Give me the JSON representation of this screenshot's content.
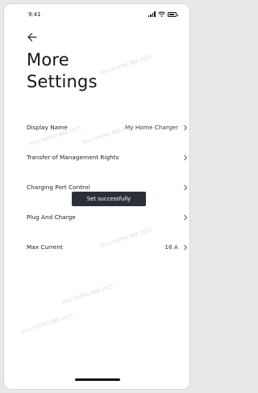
{
  "status_bar": {
    "time": "9:41"
  },
  "page": {
    "title_line1": "More",
    "title_line2": "Settings"
  },
  "settings": {
    "display_name": {
      "label": "Display Name",
      "value": "My Home Charger"
    },
    "transfer": {
      "label": "Transfer of Management Rights"
    },
    "charging_port": {
      "label": "Charging Port Control"
    },
    "plug_and_charge": {
      "label": "Plug And Charge"
    },
    "max_current": {
      "label": "Max Current",
      "value": "16 A"
    }
  },
  "toast": {
    "message": "Set successfully"
  },
  "watermark": {
    "text": "Shui SHENG 888 2023"
  },
  "colors": {
    "toast_bg": "#2b3038",
    "text": "#1b1b1b",
    "background": "#ffffff"
  }
}
